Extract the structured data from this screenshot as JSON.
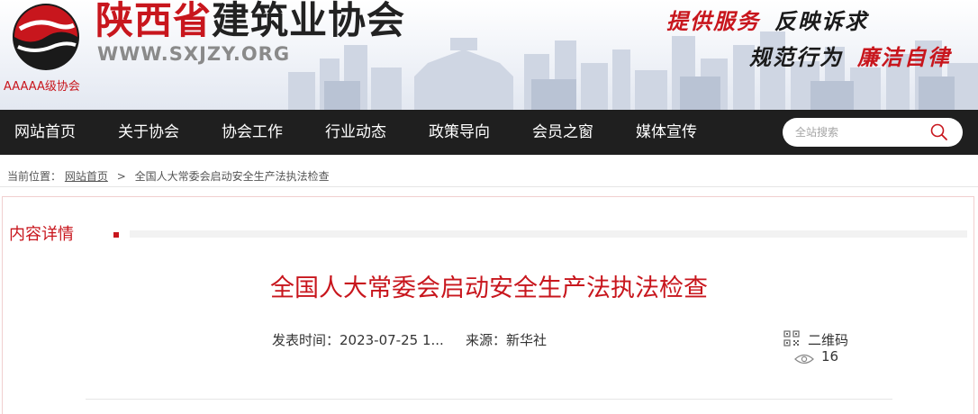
{
  "header": {
    "site_name_part1": "陕西省",
    "site_name_part2": "建筑业协会",
    "site_url": "WWW.SXJZY.ORG",
    "rating": "AAAAA级协会",
    "slogans": [
      "提供服务",
      "反映诉求",
      "规范行为",
      "廉洁自律"
    ]
  },
  "nav": {
    "items": [
      "网站首页",
      "关于协会",
      "协会工作",
      "行业动态",
      "政策导向",
      "会员之窗",
      "媒体宣传"
    ]
  },
  "search": {
    "placeholder": "全站搜索"
  },
  "breadcrumb": {
    "label": "当前位置：",
    "home": "网站首页",
    "separator": ">",
    "current": "全国人大常委会启动安全生产法执法检查"
  },
  "section": {
    "title": "内容详情"
  },
  "article": {
    "title": "全国人大常委会启动安全生产法执法检查",
    "publish_time": "发表时间：2023-07-25 1...",
    "source": "来源：新华社",
    "qr_label": "二维码",
    "views": "16"
  },
  "colors": {
    "brand_red": "#c8161d",
    "nav_bg": "#1f1f1f"
  }
}
